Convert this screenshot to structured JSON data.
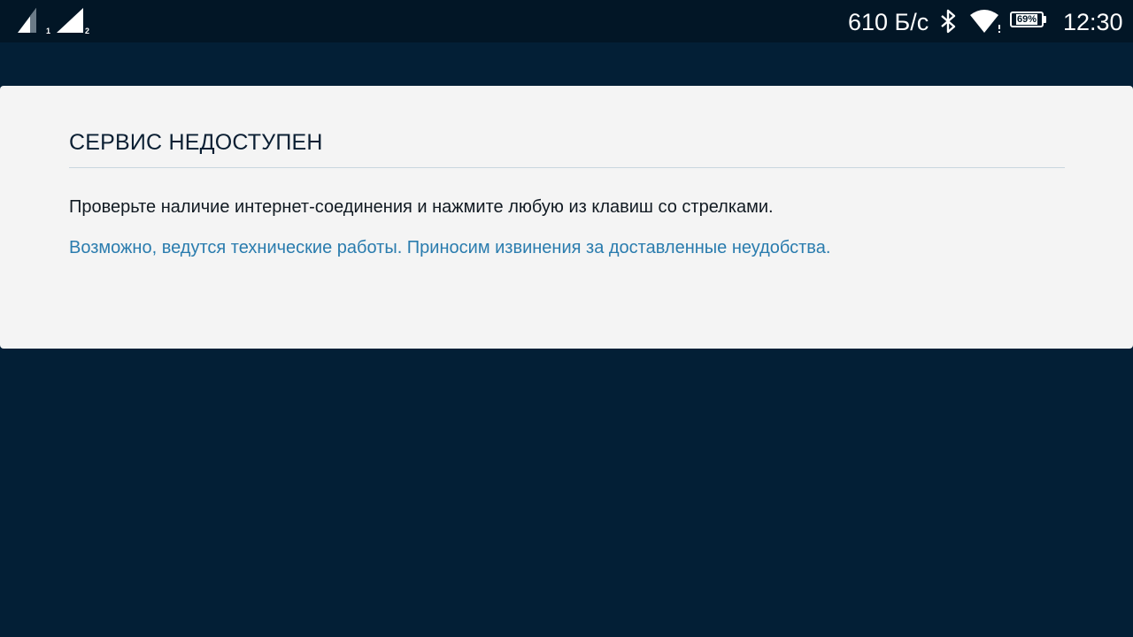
{
  "status_bar": {
    "sim1_label": "1",
    "sim2_label": "2",
    "net_speed": "610 Б/с",
    "battery_percent": "69%",
    "battery_level": 0.69,
    "time": "12:30",
    "icons": [
      "signal-sim1-icon",
      "signal-sim2-icon",
      "bluetooth-icon",
      "wifi-icon",
      "battery-icon"
    ]
  },
  "error_panel": {
    "title": "СЕРВИС НЕДОСТУПЕН",
    "message": "Проверьте наличие интернет-соединения и нажмите любую из клавиш со стрелками.",
    "note": "Возможно, ведутся технические работы. Приносим извинения за доставленные неудобства."
  },
  "colors": {
    "background": "#031f36",
    "status_bar": "#021626",
    "panel": "#f4f4f4",
    "title_text": "#0b1f33",
    "note_text": "#2a7cae"
  }
}
